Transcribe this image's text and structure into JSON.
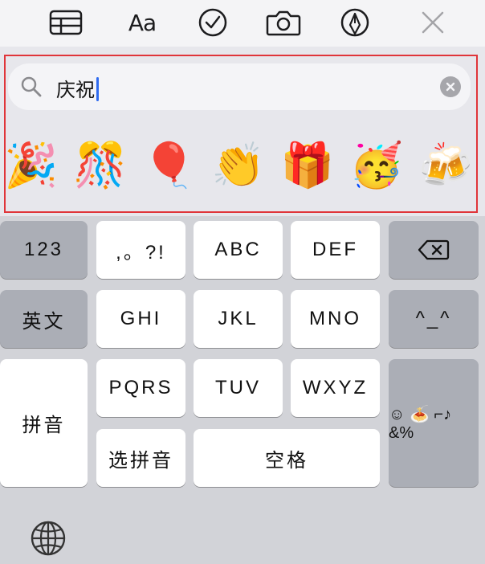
{
  "toolbar": {
    "icons": [
      "table-icon",
      "text-format-icon",
      "checkmark-circle-icon",
      "camera-icon",
      "markup-pen-icon",
      "close-icon"
    ],
    "text_format_label": "Aa"
  },
  "emoji_search": {
    "query": "庆祝",
    "results": [
      "🎉",
      "🎊",
      "🎈",
      "👏",
      "🎁",
      "🥳",
      "🍻"
    ]
  },
  "keyboard": {
    "row1": {
      "numbers": "123",
      "punct": ",。?!",
      "abc": "ABC",
      "def": "DEF"
    },
    "row2": {
      "lang": "英文",
      "ghi": "GHI",
      "jkl": "JKL",
      "mno": "MNO",
      "kaomoji": "^_^"
    },
    "row3": {
      "pinyin": "拼音",
      "pqrs": "PQRS",
      "tuv": "TUV",
      "wxyz": "WXYZ"
    },
    "row4": {
      "select_pinyin": "选拼音",
      "space": "空格"
    },
    "emoji_symbols_label": "☺ 🍝 ⌐♪ &%"
  },
  "colors": {
    "highlight_border": "#e0353a",
    "caret": "#2f6bf0",
    "keyboard_bg": "#d2d3d8",
    "dark_key": "#abaeb6"
  }
}
